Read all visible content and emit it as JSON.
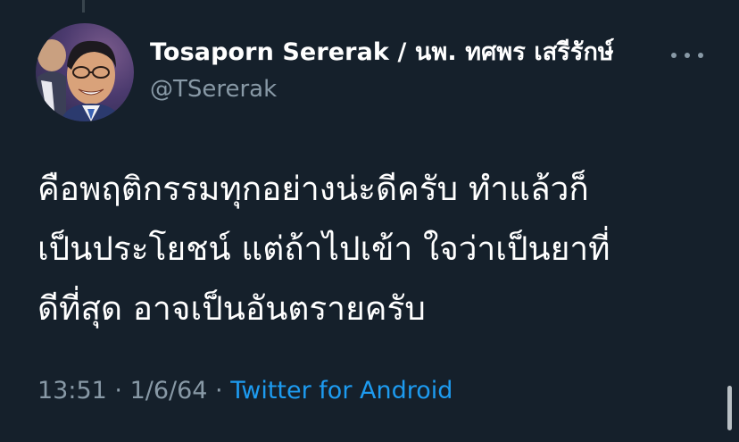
{
  "tweet": {
    "author": {
      "display_name": "Tosaporn Sererak / นพ. ทศพร เสรีรักษ์",
      "handle": "@TSererak",
      "avatar_icon": "profile-photo"
    },
    "text_lines": [
      "คือพฤติกรรมทุกอย่างน่ะดีครับ ทำแล้วก็",
      "เป็นประโยชน์ แต่ถ้าไปเข้า ใจว่าเป็นยาที่",
      "ดีที่สุด อาจเป็นอันตรายครับ"
    ],
    "meta": {
      "time": "13:51",
      "date": "1/6/64",
      "separator": " · ",
      "source": "Twitter for Android"
    },
    "more_icon": "more-horizontal-icon"
  },
  "colors": {
    "background": "#15202b",
    "primary_text": "#ffffff",
    "secondary_text": "#8899a6",
    "link": "#1d9bf0"
  }
}
